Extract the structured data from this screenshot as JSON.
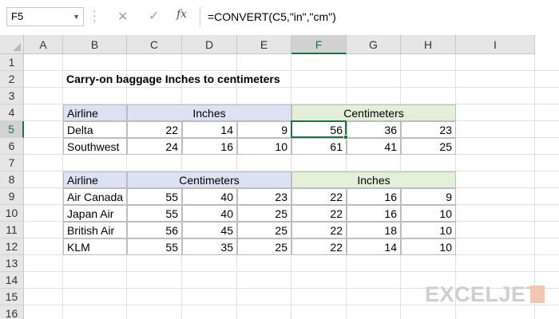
{
  "formula_bar": {
    "name_box": "F5",
    "cancel_icon": "✕",
    "enter_icon": "✓",
    "fx_label": "fx",
    "formula": "=CONVERT(C5,\"in\",\"cm\")"
  },
  "columns": [
    "A",
    "B",
    "C",
    "D",
    "E",
    "F",
    "G",
    "H",
    "I"
  ],
  "rows": [
    "1",
    "2",
    "3",
    "4",
    "5",
    "6",
    "7",
    "8",
    "9",
    "10",
    "11",
    "12",
    "13",
    "14",
    "15",
    "16"
  ],
  "selected": {
    "column": "F",
    "row": "5"
  },
  "sheet": {
    "title": "Carry-on baggage Inches to centimeters",
    "table1": {
      "airline_header": "Airline",
      "group1": "Inches",
      "group2": "Centimeters",
      "rows": [
        {
          "airline": "Delta",
          "in": [
            "22",
            "14",
            "9"
          ],
          "cm": [
            "56",
            "36",
            "23"
          ]
        },
        {
          "airline": "Southwest",
          "in": [
            "24",
            "16",
            "10"
          ],
          "cm": [
            "61",
            "41",
            "25"
          ]
        }
      ]
    },
    "table2": {
      "airline_header": "Airline",
      "group1": "Centimeters",
      "group2": "Inches",
      "rows": [
        {
          "airline": "Air Canada",
          "cm": [
            "55",
            "40",
            "23"
          ],
          "in": [
            "22",
            "16",
            "9"
          ]
        },
        {
          "airline": "Japan Air",
          "cm": [
            "55",
            "40",
            "25"
          ],
          "in": [
            "22",
            "16",
            "10"
          ]
        },
        {
          "airline": "British Air",
          "cm": [
            "56",
            "45",
            "25"
          ],
          "in": [
            "22",
            "18",
            "10"
          ]
        },
        {
          "airline": "KLM",
          "cm": [
            "55",
            "35",
            "25"
          ],
          "in": [
            "22",
            "14",
            "10"
          ]
        }
      ]
    }
  },
  "logo": "EXCELJET",
  "colors": {
    "accent": "#217346",
    "blue_header": "#dde1f4",
    "green_header": "#e3efd9"
  }
}
